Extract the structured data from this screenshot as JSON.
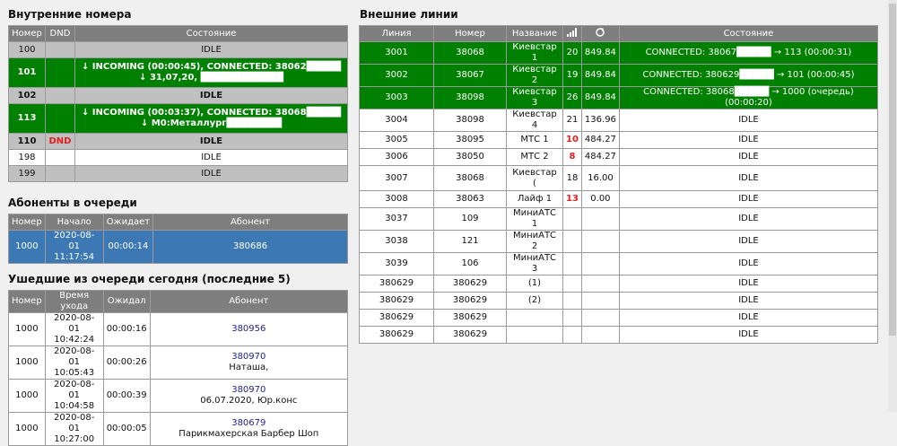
{
  "internal": {
    "title": "Внутренние номера",
    "headers": [
      "Номер",
      "DND",
      "Состояние"
    ],
    "rows": [
      {
        "num": "100",
        "dnd": "",
        "state": "IDLE",
        "cls": "gray"
      },
      {
        "num": "101",
        "dnd": "",
        "state": "↓ INCOMING (00:00:45), CONNECTED: 38062█████ ↓ 31,07,20, ████████████",
        "cls": "green bold"
      },
      {
        "num": "102",
        "dnd": "",
        "state": "IDLE",
        "cls": "gray bold"
      },
      {
        "num": "113",
        "dnd": "",
        "state": "↓ INCOMING (00:03:37), CONNECTED: 38068█████ ↓ М0:Металлург████████",
        "cls": "green bold"
      },
      {
        "num": "110",
        "dnd": "DND",
        "state": "IDLE",
        "cls": "gray bold"
      },
      {
        "num": "198",
        "dnd": "",
        "state": "IDLE",
        "cls": "white"
      },
      {
        "num": "199",
        "dnd": "",
        "state": "IDLE",
        "cls": "gray"
      }
    ]
  },
  "queue": {
    "title": "Абоненты в очереди",
    "headers": [
      "Номер",
      "Начало",
      "Ожидает",
      "Абонент"
    ],
    "rows": [
      {
        "num": "1000",
        "start": "2020-08-01 11:17:54",
        "wait": "00:00:14",
        "caller": "380686"
      }
    ]
  },
  "left": {
    "title": "Ушедшие из очереди сегодня (последние 5)",
    "headers": [
      "Номер",
      "Время ухода",
      "Ожидал",
      "Абонент"
    ],
    "rows": [
      {
        "num": "1000",
        "time": "2020-08-01 10:42:24",
        "wait": "00:00:16",
        "caller": "380956",
        "extra": ""
      },
      {
        "num": "1000",
        "time": "2020-08-01 10:05:43",
        "wait": "00:00:26",
        "caller": "380970",
        "extra": "Наташа,"
      },
      {
        "num": "1000",
        "time": "2020-08-01 10:04:58",
        "wait": "00:00:39",
        "caller": "380970",
        "extra": "06.07.2020, Юр.конс"
      },
      {
        "num": "1000",
        "time": "2020-08-01 10:27:00",
        "wait": "00:00:05",
        "caller": "380679",
        "extra": "Парикмахерская Барбер Шоп"
      }
    ]
  },
  "external": {
    "title": "Внешние линии",
    "headers": [
      "Линия",
      "Номер",
      "Название",
      "signal-icon",
      "refresh-icon",
      "Состояние"
    ],
    "rows": [
      {
        "line": "3001",
        "num": "38068",
        "name": "Киевстар 1",
        "sig": "20",
        "bal": "849.84",
        "state": "CONNECTED: 38067█████ → 113 (00:00:31)",
        "cls": "green",
        "red": false
      },
      {
        "line": "3002",
        "num": "38067",
        "name": "Киевстар 2",
        "sig": "19",
        "bal": "849.84",
        "state": "CONNECTED: 380629█████ → 101 (00:00:45)",
        "cls": "green",
        "red": false
      },
      {
        "line": "3003",
        "num": "38098",
        "name": "Киевстар 3",
        "sig": "26",
        "bal": "849.84",
        "state": "CONNECTED: 38068█████ → 1000 (очередь) (00:00:20)",
        "cls": "green",
        "red": false
      },
      {
        "line": "3004",
        "num": "38098",
        "name": "Киевстар 4",
        "sig": "21",
        "bal": "136.96",
        "state": "IDLE",
        "cls": "white",
        "red": false
      },
      {
        "line": "3005",
        "num": "38095",
        "name": "МТС 1",
        "sig": "10",
        "bal": "484.27",
        "state": "IDLE",
        "cls": "white",
        "red": true
      },
      {
        "line": "3006",
        "num": "38050",
        "name": "МТС 2",
        "sig": "8",
        "bal": "484.27",
        "state": "IDLE",
        "cls": "white",
        "red": true
      },
      {
        "line": "3007",
        "num": "38068",
        "name": "Киевстар (",
        "sig": "18",
        "bal": "16.00",
        "state": "IDLE",
        "cls": "white",
        "red": false
      },
      {
        "line": "3008",
        "num": "38063",
        "name": "Лайф 1",
        "sig": "13",
        "bal": "0.00",
        "state": "IDLE",
        "cls": "white",
        "red": true
      },
      {
        "line": "3037",
        "num": "109",
        "name": "МиниАТС 1",
        "sig": "",
        "bal": "",
        "state": "IDLE",
        "cls": "white",
        "red": false
      },
      {
        "line": "3038",
        "num": "121",
        "name": "МиниАТС 2",
        "sig": "",
        "bal": "",
        "state": "IDLE",
        "cls": "white",
        "red": false
      },
      {
        "line": "3039",
        "num": "106",
        "name": "МиниАТС 3",
        "sig": "",
        "bal": "",
        "state": "IDLE",
        "cls": "white",
        "red": false
      },
      {
        "line": "380629",
        "num": "380629",
        "name": "(1)",
        "sig": "",
        "bal": "",
        "state": "IDLE",
        "cls": "white",
        "red": false
      },
      {
        "line": "380629",
        "num": "380629",
        "name": "(2)",
        "sig": "",
        "bal": "",
        "state": "IDLE",
        "cls": "white",
        "red": false
      },
      {
        "line": "380629",
        "num": "380629",
        "name": "",
        "sig": "",
        "bal": "",
        "state": "IDLE",
        "cls": "white",
        "red": false
      },
      {
        "line": "380629",
        "num": "380629",
        "name": "",
        "sig": "",
        "bal": "",
        "state": "IDLE",
        "cls": "white",
        "red": false
      }
    ]
  }
}
